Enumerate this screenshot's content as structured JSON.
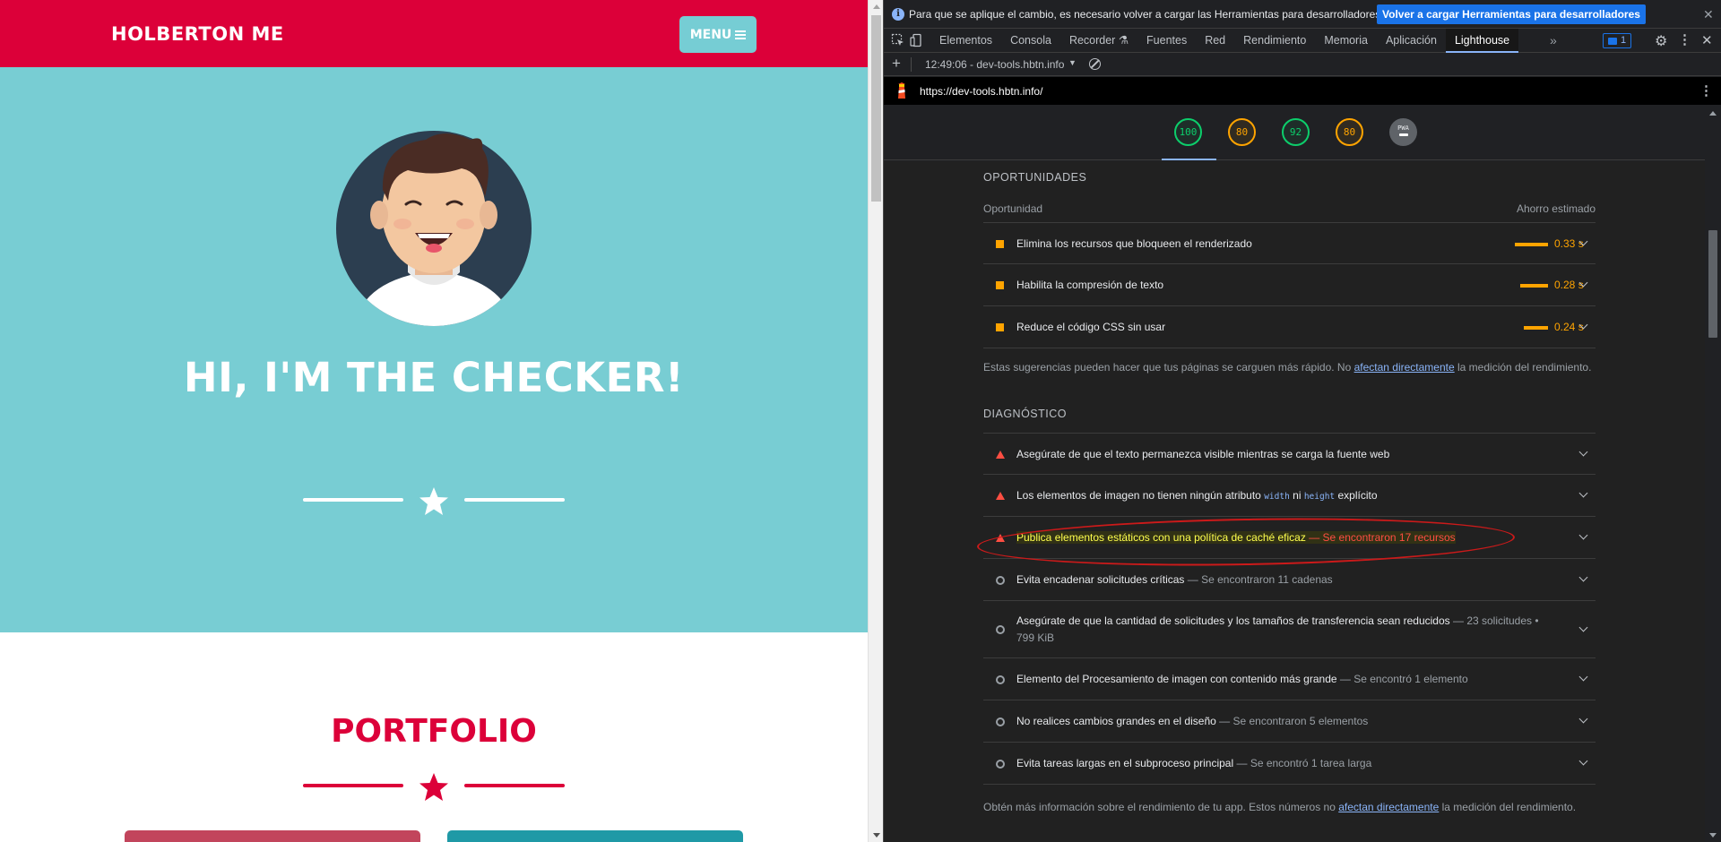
{
  "site": {
    "brand": "HOLBERTON ME",
    "menu_label": "MENU",
    "hero_title": "HI, I'M THE CHECKER!",
    "portfolio_title": "PORTFOLIO",
    "colors": {
      "nav": "#dc0039",
      "hero": "#78cdd3",
      "menu_button": "#76cdd4"
    }
  },
  "devtools": {
    "info_bar": {
      "text": "Para que se aplique el cambio, es necesario volver a cargar las Herramientas para desarrolladores.",
      "button": "Volver a cargar Herramientas para desarrolladores"
    },
    "tabs": [
      {
        "label": "Elementos"
      },
      {
        "label": "Consola"
      },
      {
        "label": "Recorder ⚗"
      },
      {
        "label": "Fuentes"
      },
      {
        "label": "Red"
      },
      {
        "label": "Rendimiento"
      },
      {
        "label": "Memoria"
      },
      {
        "label": "Aplicación"
      },
      {
        "label": "Lighthouse"
      }
    ],
    "active_tab": "Lighthouse",
    "issues_count": "1",
    "report_select": "12:49:06 - dev-tools.hbtn.info",
    "url": "https://dev-tools.hbtn.info/",
    "gauges": [
      {
        "score": "100",
        "status": "pass"
      },
      {
        "score": "80",
        "status": "average"
      },
      {
        "score": "92",
        "status": "pass"
      },
      {
        "score": "80",
        "status": "average"
      },
      {
        "label": "PWA",
        "status": "n/a"
      }
    ],
    "opportunities": {
      "section_title": "OPORTUNIDADES",
      "col_left": "Oportunidad",
      "col_right": "Ahorro estimado",
      "items": [
        {
          "title": "Elimina los recursos que bloqueen el renderizado",
          "savings": "0.33 s",
          "fraction": 1.0
        },
        {
          "title": "Habilita la compresión de texto",
          "savings": "0.28 s",
          "fraction": 0.85
        },
        {
          "title": "Reduce el código CSS sin usar",
          "savings": "0.24 s",
          "fraction": 0.73
        }
      ],
      "note_before": "Estas sugerencias pueden hacer que tus páginas se carguen más rápido. No ",
      "note_link": "afectan directamente",
      "note_after": " la medición del rendimiento."
    },
    "diagnostics": {
      "section_title": "DIAGNÓSTICO",
      "items": [
        {
          "title": "Asegúrate de que el texto permanezca visible mientras se carga la fuente web",
          "detail": "",
          "severity": "fail"
        },
        {
          "title_before": "Los elementos de imagen no tienen ningún atributo ",
          "code1": "width",
          "title_mid": " ni ",
          "code2": "height",
          "title_after": " explícito",
          "severity": "fail"
        },
        {
          "title": "Publica elementos estáticos con una política de caché eficaz",
          "detail": "— Se encontraron 17 recursos",
          "severity": "fail",
          "highlighted": true
        },
        {
          "title": "Evita encadenar solicitudes críticas",
          "detail": "— Se encontraron 11 cadenas",
          "severity": "info"
        },
        {
          "title": "Asegúrate de que la cantidad de solicitudes y los tamaños de transferencia sean reducidos",
          "detail": "— 23 solicitudes •",
          "detail2": "799 KiB",
          "severity": "info"
        },
        {
          "title": "Elemento del Procesamiento de imagen con contenido más grande",
          "detail": "— Se encontró 1 elemento",
          "severity": "info"
        },
        {
          "title": "No realices cambios grandes en el diseño",
          "detail": "— Se encontraron 5 elementos",
          "severity": "info"
        },
        {
          "title": "Evita tareas largas en el subproceso principal",
          "detail": "— Se encontró 1 tarea larga",
          "severity": "info"
        }
      ],
      "note_before": "Obtén más información sobre el rendimiento de tu app. Estos números no ",
      "note_link": "afectan directamente",
      "note_after": " la medición del rendimiento."
    },
    "colors": {
      "pass": "#0cce6b",
      "average": "#ffa400",
      "fail": "#ff4e42",
      "link": "#8ab4f8"
    }
  }
}
